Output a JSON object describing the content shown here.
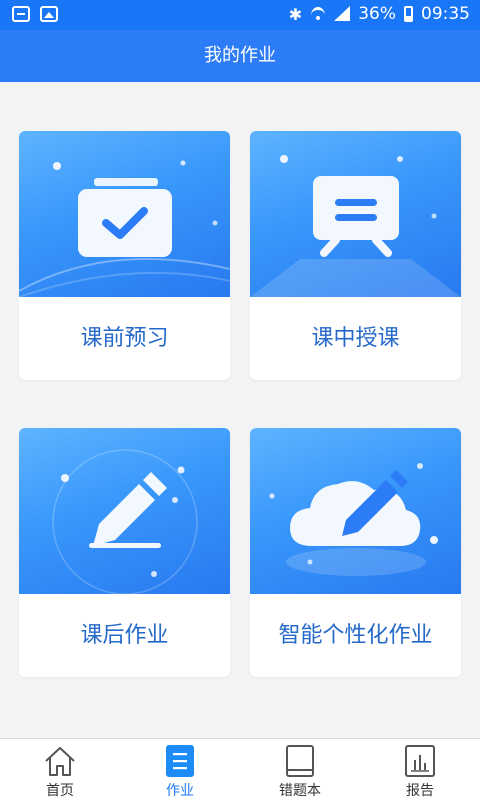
{
  "status_bar": {
    "battery": "36%",
    "time": "09:35",
    "icons": [
      "message-icon",
      "image-icon",
      "bluetooth-icon",
      "wifi-icon",
      "signal-icon",
      "battery-icon"
    ]
  },
  "app_bar": {
    "title": "我的作业"
  },
  "cards": [
    {
      "label": "课前预习",
      "icon": "clipboard-check-icon"
    },
    {
      "label": "课中授课",
      "icon": "easel-board-icon"
    },
    {
      "label": "课后作业",
      "icon": "pencil-icon"
    },
    {
      "label": "智能个性化作业",
      "icon": "cloud-pencil-icon"
    }
  ],
  "tab_bar": {
    "active": "作业",
    "tabs": [
      {
        "label": "首页",
        "icon": "home-icon"
      },
      {
        "label": "作业",
        "icon": "list-icon"
      },
      {
        "label": "错题本",
        "icon": "book-icon"
      },
      {
        "label": "报告",
        "icon": "chart-icon"
      }
    ]
  },
  "colors": {
    "accent": "#2b7cf6",
    "status_bar": "#1976f7",
    "label_text": "#2569c9",
    "background": "#f2f3f5"
  }
}
